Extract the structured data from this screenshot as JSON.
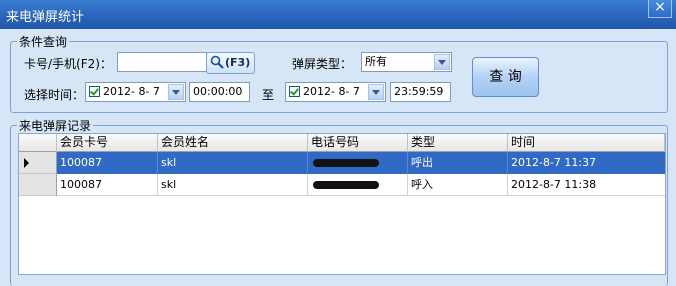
{
  "window": {
    "title": "来电弹屏统计",
    "close_glyph": "×"
  },
  "query": {
    "legend": "条件查询",
    "card_label": "卡号/手机(F2)：",
    "card_value": "",
    "f3_label": "(F3)",
    "type_label": "弹屏类型：",
    "type_value": "所有",
    "time_label": "选择时间：",
    "start_date": "2012- 8- 7",
    "start_time": "00:00:00",
    "to_label": "至",
    "end_date": "2012- 8- 7",
    "end_time": "23:59:59",
    "query_button": "查 询"
  },
  "records": {
    "legend": "来电弹屏记录",
    "columns": [
      "会员卡号",
      "会员姓名",
      "电话号码",
      "类型",
      "时间"
    ],
    "rows": [
      {
        "card": "100087",
        "name": "skl",
        "phone": "",
        "type": "呼出",
        "time": "2012-8-7 11:37",
        "selected": true
      },
      {
        "card": "100087",
        "name": "skl",
        "phone": "",
        "type": "呼入",
        "time": "2012-8-7 11:38",
        "selected": false
      }
    ]
  },
  "icons": {
    "search": "magnifier-icon",
    "dropdown": "chevron-down-icon",
    "row_pointer": "row-pointer-icon"
  }
}
